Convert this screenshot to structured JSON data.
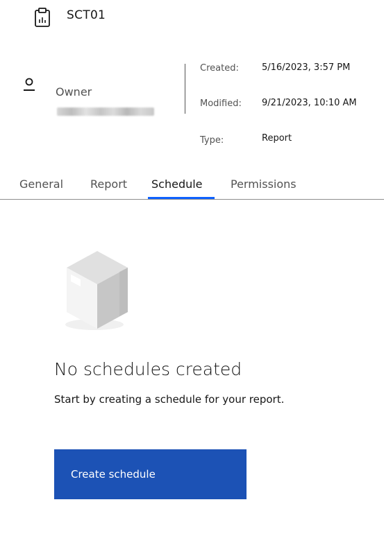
{
  "header": {
    "title": "SCT01",
    "icon": "report-icon"
  },
  "owner": {
    "label": "Owner",
    "icon": "user-icon"
  },
  "meta": {
    "created_label": "Created:",
    "created_value": "5/16/2023, 3:57 PM",
    "modified_label": "Modified:",
    "modified_value": "9/21/2023, 10:10 AM",
    "type_label": "Type:",
    "type_value": "Report"
  },
  "tabs": [
    {
      "label": "General"
    },
    {
      "label": "Report"
    },
    {
      "label": "Schedule",
      "active": true
    },
    {
      "label": "Permissions"
    }
  ],
  "empty_state": {
    "title": "No schedules created",
    "description": "Start by creating a schedule for your report.",
    "illustration": "box-icon"
  },
  "actions": {
    "create_label": "Create schedule"
  },
  "colors": {
    "accent": "#0f62fe",
    "button": "#1c52b5",
    "text": "#161616",
    "muted": "#525252"
  }
}
